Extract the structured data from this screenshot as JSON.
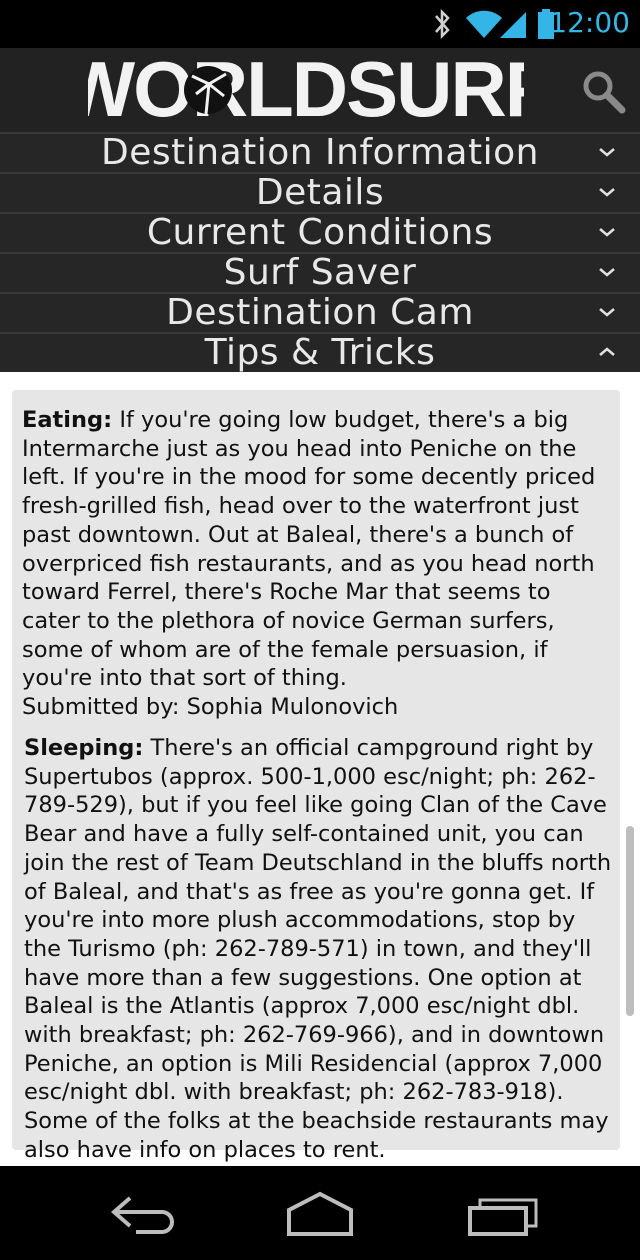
{
  "status_bar": {
    "time": "12:00",
    "icons": [
      "bluetooth-icon",
      "wifi-icon",
      "signal-icon",
      "battery-icon"
    ],
    "accent_color": "#33b5e5"
  },
  "header": {
    "logo_text": "WORLDSURF",
    "search_icon": "search-icon",
    "background": "#222222"
  },
  "sections": [
    {
      "label": "Destination Information",
      "state": "collapsed"
    },
    {
      "label": "Details",
      "state": "collapsed"
    },
    {
      "label": "Current Conditions",
      "state": "collapsed"
    },
    {
      "label": "Surf Saver",
      "state": "collapsed"
    },
    {
      "label": "Destination Cam",
      "state": "collapsed"
    },
    {
      "label": "Tips & Tricks",
      "state": "expanded"
    }
  ],
  "tips": [
    {
      "heading": "Eating:",
      "body": "If you're going low budget, there's a big Intermarche just as you head into Peniche on the left. If you're in the mood for some decently priced fresh-grilled fish, head over to the waterfront just past downtown. Out at Baleal, there's a bunch of overpriced fish restaurants, and as you head north toward Ferrel, there's Roche Mar that seems to cater to the plethora of novice German surfers, some of whom are of the female persuasion, if you're into that sort of thing.",
      "submitted_by": "Submitted by: Sophia Mulonovich"
    },
    {
      "heading": "Sleeping:",
      "body": "There's an official campground right by Supertubos (approx. 500-1,000 esc/night; ph: 262-789-529), but if you feel like going Clan of the Cave Bear and have a fully self-contained unit, you can join the rest of Team Deutschland in the bluffs north of Baleal, and that's as free as you're gonna get. If you're into more plush accommodations, stop by the Turismo (ph: 262-789-571) in town, and they'll have more than a few suggestions. One option at Baleal is the Atlantis (approx 7,000 esc/night dbl. with breakfast; ph: 262-769-966), and in downtown Peniche, an option is Mili Residencial (approx 7,000 esc/night dbl. with breakfast; ph: 262-783-918). Some of the folks at the beachside restaurants may also have info on places to rent."
    }
  ],
  "nav": {
    "buttons": [
      "back-icon",
      "home-icon",
      "recent-apps-icon"
    ]
  }
}
